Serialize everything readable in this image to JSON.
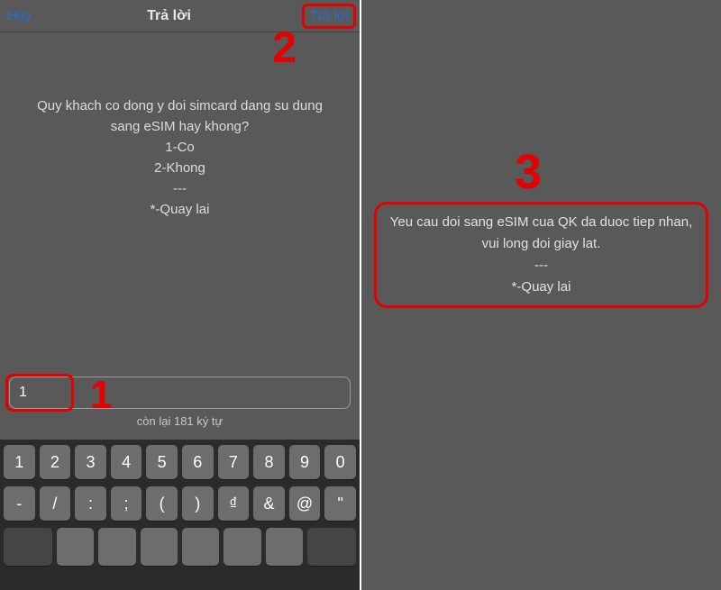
{
  "nav": {
    "cancel": "Hủy",
    "title": "Trả lời",
    "reply": "Trả lời"
  },
  "left_message": {
    "l1": "Quy khach co dong y doi simcard dang su dung",
    "l2": "sang eSIM hay khong?",
    "l3": "1-Co",
    "l4": "2-Khong",
    "l5": "---",
    "l6": "*-Quay lai"
  },
  "input": {
    "value": "1",
    "chars_left": "còn lại 181 ký tự"
  },
  "keyboard": {
    "r1": [
      "1",
      "2",
      "3",
      "4",
      "5",
      "6",
      "7",
      "8",
      "9",
      "0"
    ],
    "r2": [
      "-",
      "/",
      ":",
      ";",
      "(",
      ")",
      "₫",
      "&",
      "@",
      "\""
    ]
  },
  "right_message": {
    "l1": "Yeu cau doi sang eSIM cua QK da duoc tiep nhan,",
    "l2": "vui long doi giay lat.",
    "l3": "---",
    "l4": "*-Quay lai"
  },
  "annotations": {
    "n1": "1",
    "n2": "2",
    "n3": "3"
  }
}
